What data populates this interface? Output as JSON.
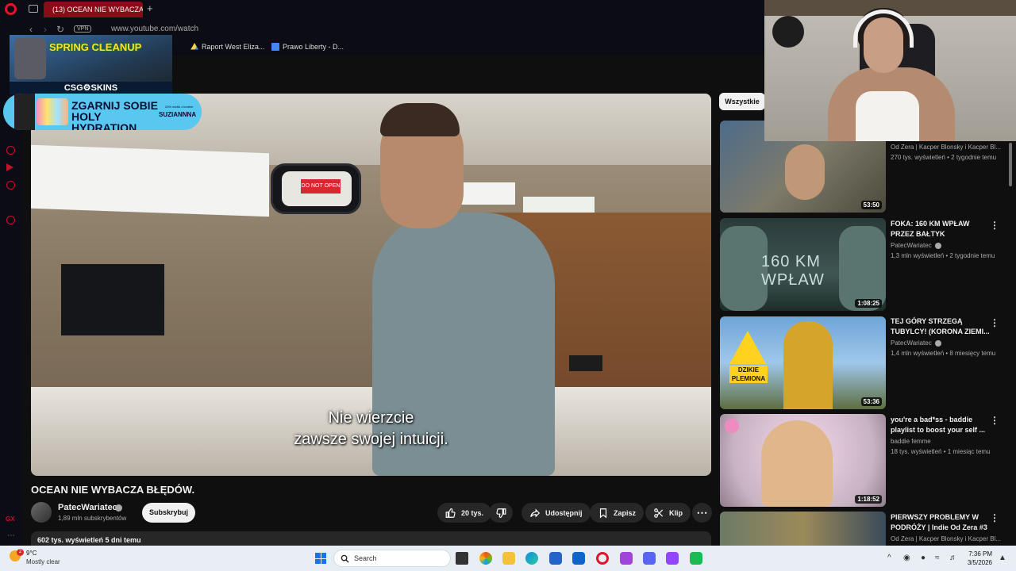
{
  "browser": {
    "tab_title": "(13) OCEAN NIE WYBACZA",
    "new_tab": "+",
    "vpn": "VPN",
    "url": "www.youtube.com/watch",
    "bookmarks": [
      {
        "label": "Raport West Eliza..."
      },
      {
        "label": "Prawo Liberty - D..."
      }
    ]
  },
  "overlay": {
    "spring_title": "SPRING CLEANUP",
    "spring_brand": "CSG⚙SKINS",
    "promo_text": "ZGARNIJ SOBIE HOLY HYDRATION",
    "promo_code": "SUZIANNNA",
    "promo_small": "20% zniżki z kodem"
  },
  "video": {
    "subtitle_line1": "Nie wierzcie",
    "subtitle_line2": "zawsze swojej intuicji.",
    "sign_text": "DO NOT OPEN",
    "title": "OCEAN NIE WYBACZA BŁĘDÓW.",
    "channel": "PatecWariatec",
    "subscribers": "1,89 mln subskrybentów",
    "subscribe_label": "Subskrybuj",
    "likes": "20 tys.",
    "share_label": "Udostępnij",
    "save_label": "Zapisz",
    "clip_label": "Klip",
    "more": "⋯",
    "description_meta": "602 tys. wyświetleń  5 dni temu"
  },
  "sidebar_right": {
    "filter_chip": "Wszystkie",
    "recommendations": [
      {
        "title": "",
        "channel": "Od Zera | Kacper Blonsky i Kacper Bl...",
        "meta": "270 tys. wyświetleń • 2 tygodnie temu",
        "duration": "53:50"
      },
      {
        "title": "FOKA: 160 KM WPŁAW PRZEZ BAŁTYK",
        "channel": "PatecWariatec",
        "meta": "1,3 mln wyświetleń • 2 tygodnie temu",
        "duration": "1:08:25",
        "thumb_text": "160 KM WPŁAW"
      },
      {
        "title": "TEJ GÓRY STRZEGĄ TUBYLCY! (KORONA ZIEMI...",
        "channel": "PatecWariatec",
        "meta": "1,4 mln wyświetleń • 8 miesięcy temu",
        "duration": "53:36",
        "thumb_text": "DZIKIE PLEMIONA"
      },
      {
        "title": "you're a bad*ss - baddie playlist to boost your self ...",
        "channel": "baddie femme",
        "meta": "18 tys. wyświetleń • 1 miesiąc temu",
        "duration": "1:18:52"
      },
      {
        "title": "PIERWSZY PROBLEMY W PODRÓŻY | Indie Od Zera #3",
        "channel": "Od Zera | Kacper Blonsky i Kacper Bl...",
        "meta": "",
        "duration": ""
      }
    ],
    "more_icon": "⋮"
  },
  "taskbar": {
    "weather_temp": "9°C",
    "weather_cond": "Mostly clear",
    "weather_badge": "2",
    "search_label": "Search",
    "time": "7:36 PM",
    "date": "3/5/2026"
  },
  "colors": {
    "opera_red": "#e0142b",
    "active_tab": "#8a0c18",
    "youtube_bg": "#0f0f0f",
    "taskbar": "#e9eef5"
  }
}
